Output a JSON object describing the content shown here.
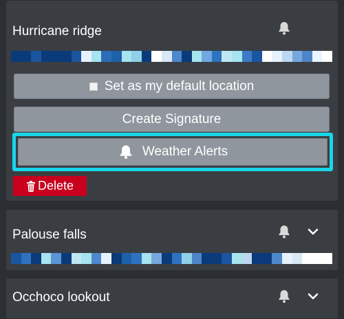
{
  "locations": [
    {
      "name": "Hurricane ridge",
      "icons": [
        "bell-icon"
      ],
      "forecast_colors": [
        "#0b3a7a",
        "#0b3a7a",
        "#1a55a0",
        "#0b3a7a",
        "#0b3a7a",
        "#0b3a7a",
        "#1a55a0",
        "#e8f2ff",
        "#a6e4ef",
        "#2b6db6",
        "#1d61a8",
        "#a6e4ef",
        "#8fd0e8",
        "#0b3a7a",
        "#ffffff",
        "#d8e8f7",
        "#4e88cc",
        "#0b3a7a",
        "#a6e4ef",
        "#6fa8e0",
        "#2f72c0",
        "#bfe6f2",
        "#a6e4ef",
        "#3c7ac8",
        "#1a55a0",
        "#ffffff",
        "#e8f2ff",
        "#bcd7ef",
        "#77a7dc",
        "#4d85c8",
        "#e9f4ff",
        "#ffffff"
      ]
    },
    {
      "name": "Palouse falls",
      "icons": [
        "bell-icon",
        "chevron-down-icon"
      ],
      "forecast_colors": [
        "#1a55a0",
        "#2f72c0",
        "#0b3a7a",
        "#a6e4ef",
        "#5b95d6",
        "#0b3a7a",
        "#bfe6f2",
        "#a6e4ef",
        "#4e88cc",
        "#e8f2ff",
        "#0b3a7a",
        "#1d61a8",
        "#2f72c0",
        "#a6e4ef",
        "#77a7dc",
        "#0b3a7a",
        "#2f72c0",
        "#8fd0e8",
        "#4d85c8",
        "#0b3a7a",
        "#0b3a7a",
        "#1a55a0",
        "#a6e4ef",
        "#bcd7ef",
        "#0b3a7a",
        "#0b3a7a",
        "#4e88cc",
        "#e8f2ff",
        "#d8e8f7",
        "#ffffff",
        "#ffffff",
        "#ffffff"
      ]
    },
    {
      "name": "Occhoco lookout",
      "icons": [
        "bell-icon",
        "chevron-down-icon"
      ]
    }
  ],
  "actions": {
    "default_location_label": "Set as my default location",
    "create_signature_label": "Create Signature",
    "weather_alerts_label": "Weather Alerts",
    "delete_label": "Delete"
  },
  "colors": {
    "card_bg": "#3a3e43",
    "button_bg": "#8f969d",
    "highlight": "#18d6ea",
    "delete_bg": "#c8001e"
  }
}
